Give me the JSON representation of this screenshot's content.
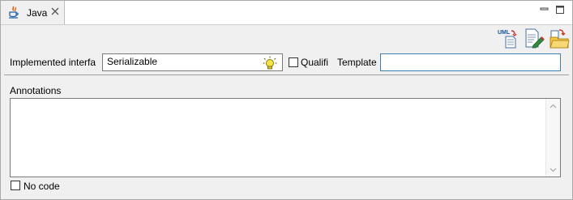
{
  "tab": {
    "label": "Java"
  },
  "fields": {
    "implemented_label": "Implemented interfa",
    "implemented_value": "Serializable",
    "qualified_label": "Qualifi",
    "template_label": "Template",
    "template_value": ""
  },
  "annotations": {
    "label": "Annotations",
    "value": ""
  },
  "no_code": {
    "label": "No code",
    "checked": false
  },
  "toolbar": {
    "icons": [
      "uml-generate-icon",
      "edit-document-icon",
      "open-folder-icon"
    ]
  }
}
